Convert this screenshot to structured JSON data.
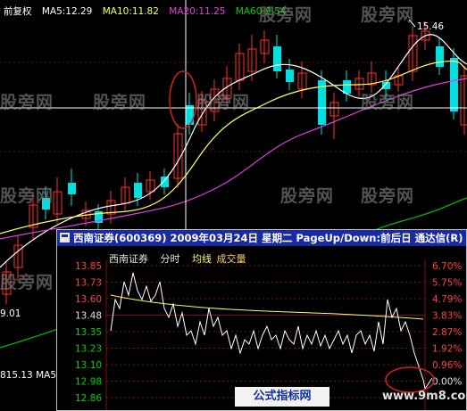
{
  "ma_legend": {
    "label": "前复权",
    "ma5": "MA5:12.29",
    "ma10": "MA10:11.82",
    "ma20": "MA20:11.25",
    "ma60": "MA60:9.54"
  },
  "kline": {
    "high_label": "15.46",
    "low_label": "9.01",
    "volume_label": "815.13",
    "volume_ma_label": "MA5"
  },
  "popup": {
    "title": "西南证券(600369) 2009年03月24日 星期二 PageUp/Down:前后日 通达信(R)",
    "legend": {
      "name": "西南证券",
      "time": "分时",
      "avg": "均线",
      "volume": "成交量"
    },
    "price_ticks": [
      "13.85",
      "13.73",
      "13.60",
      "13.48",
      "13.35",
      "13.23",
      "13.10",
      "12.98",
      "12.86"
    ],
    "pct_ticks": [
      "6.70%",
      "5.75%",
      "4.79%",
      "3.83%",
      "2.87%",
      "1.92%",
      "0.96%",
      "0.00%"
    ]
  },
  "watermarks": [
    "股旁网",
    "股旁网",
    "股旁网",
    "股旁网",
    "股旁网",
    "股旁网",
    "股旁网",
    "股旁网",
    "股旁网",
    "股旁网",
    "股旁网",
    "股旁网"
  ],
  "badge": {
    "logo_text": "公式指标网",
    "site": "www.9m8.com"
  },
  "colors": {
    "up": "#ff3030",
    "down": "#00e0e0",
    "ma5": "#ffffff",
    "ma10": "#ffff66",
    "ma20": "#e040e0",
    "ma60": "#00c000",
    "cursor": "#ffffff",
    "grid": "#7a1010"
  }
}
